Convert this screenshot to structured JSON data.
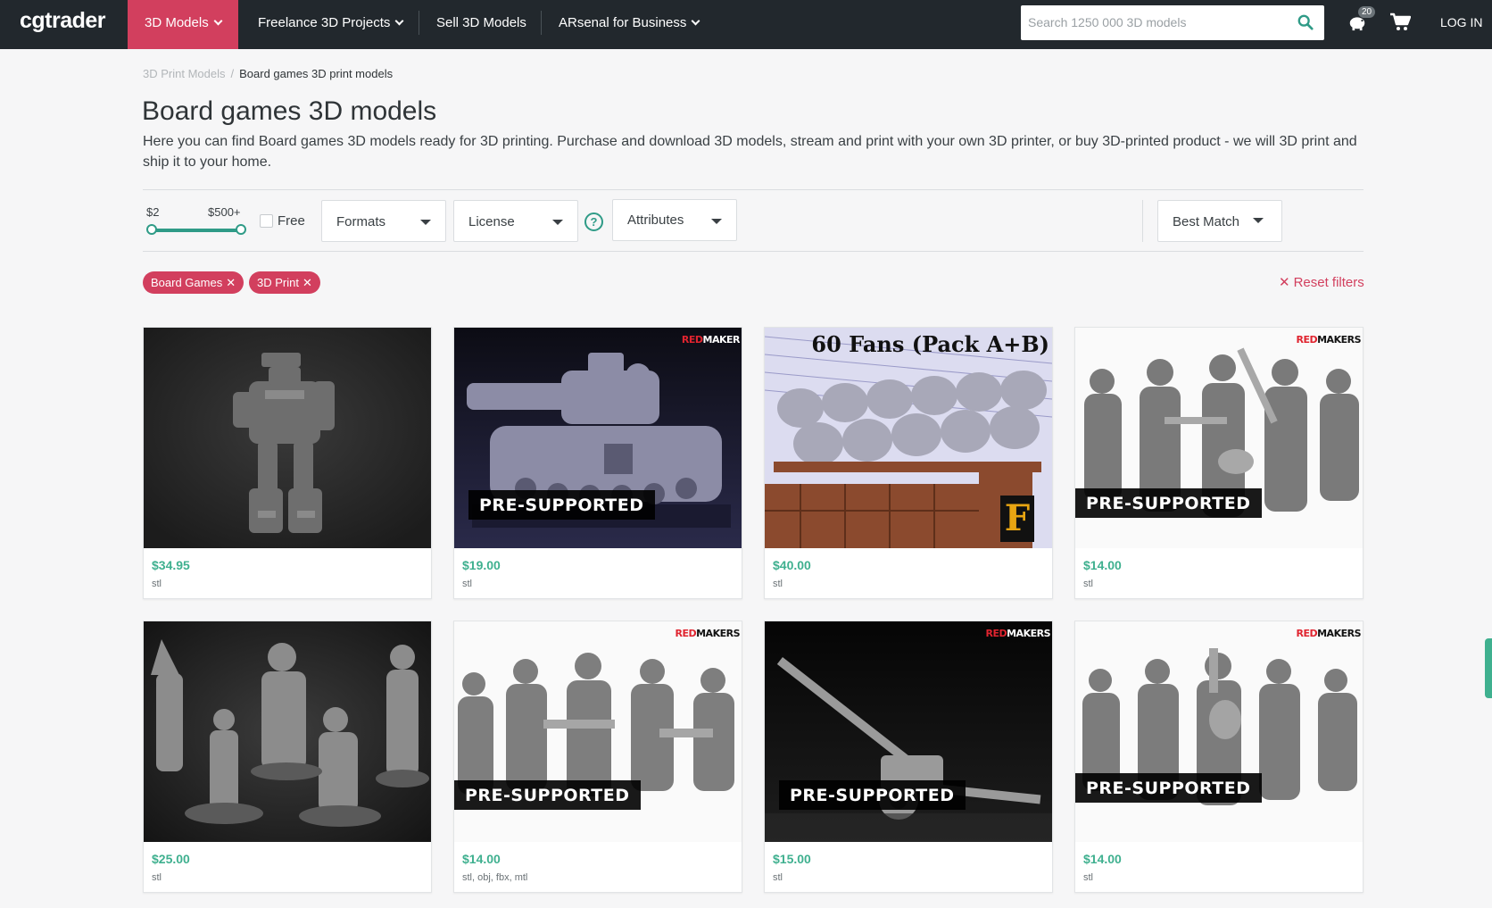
{
  "nav": {
    "logo": "cgtrader",
    "items": [
      {
        "label": "3D Models",
        "dropdown": true,
        "active": true
      },
      {
        "label": "Freelance 3D Projects",
        "dropdown": true
      },
      {
        "label": "Sell 3D Models",
        "dropdown": false
      },
      {
        "label": "ARsenal for Business",
        "dropdown": true
      }
    ],
    "search_placeholder": "Search 1250 000 3D models",
    "notifications_count": "20",
    "login_label": "LOG IN"
  },
  "breadcrumb": {
    "parent": "3D Print Models",
    "separator": "/",
    "current": "Board games 3D print models"
  },
  "page": {
    "title": "Board games 3D models",
    "description": "Here you can find Board games 3D models ready for 3D printing. Purchase and download 3D models, stream and print with your own 3D printer, or buy 3D-printed product - we will 3D print and ship it to your home."
  },
  "filters": {
    "price_min": "$2",
    "price_max": "$500+",
    "free_label": "Free",
    "formats_label": "Formats",
    "license_label": "License",
    "help_label": "?",
    "attributes_label": "Attributes",
    "sort_label": "Best Match"
  },
  "active_filters": {
    "tags": [
      "Board Games",
      "3D Print"
    ],
    "remove_symbol": "✕",
    "reset_label": "Reset filters"
  },
  "products": [
    {
      "price": "$34.95",
      "formats": "stl",
      "image": "mech-walker"
    },
    {
      "price": "$19.00",
      "formats": "stl",
      "image": "tank",
      "badge": "PRE-SUPPORTED",
      "brand_red": "RED",
      "brand": "MAKER"
    },
    {
      "price": "$40.00",
      "formats": "stl",
      "image": "stadium-fans",
      "overlay_title": "60 Fans (Pack A+B)",
      "logo_letter": "F"
    },
    {
      "price": "$14.00",
      "formats": "stl",
      "image": "soldiers",
      "badge": "PRE-SUPPORTED",
      "brand_red": "RED",
      "brand": "MAKERS"
    },
    {
      "price": "$25.00",
      "formats": "stl",
      "image": "fantasy-heroes"
    },
    {
      "price": "$14.00",
      "formats": "stl, obj, fbx, mtl",
      "image": "soldiers",
      "badge": "PRE-SUPPORTED",
      "brand_red": "RED",
      "brand": "MAKERS"
    },
    {
      "price": "$15.00",
      "formats": "stl",
      "image": "artillery",
      "badge": "PRE-SUPPORTED",
      "brand_red": "RED",
      "brand": "MAKERS"
    },
    {
      "price": "$14.00",
      "formats": "stl",
      "image": "soldiers",
      "badge": "PRE-SUPPORTED",
      "brand_red": "RED",
      "brand": "MAKERS"
    }
  ],
  "colors": {
    "nav_bg": "#22282d",
    "accent": "#d23f5e",
    "price": "#3fb08f",
    "slider": "#2f9b87"
  }
}
